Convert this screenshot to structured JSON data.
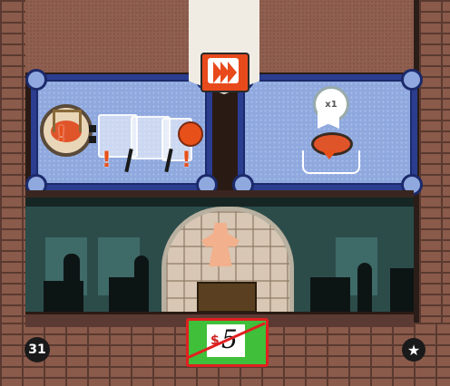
{
  "banner": {
    "icon": "conveyor-chevrons-icon"
  },
  "left_panel": {
    "icons": [
      "roll-track-token-icon",
      "card-slot-icon",
      "card-slot-icon",
      "card-slot-icon",
      "red-token-icon"
    ],
    "warning_marks": [
      "!",
      "!",
      "!"
    ]
  },
  "right_panel": {
    "reward_badge": "x1",
    "icons": [
      "ribbon-medal-icon",
      "red-disk-icon",
      "down-arrow-icon"
    ]
  },
  "room": {
    "icons": [
      "meeple-icon",
      "desk-icon",
      "worker-silhouette-icon",
      "machine-silhouette-icon"
    ]
  },
  "price_tag": {
    "currency": "$",
    "value": "5",
    "crossed_out": true
  },
  "round_counter": "31",
  "star_icon": "star-icon",
  "colors": {
    "panel_blue": "#8fa9df",
    "accent_orange": "#e8501a",
    "price_green": "#3fbf3a"
  }
}
